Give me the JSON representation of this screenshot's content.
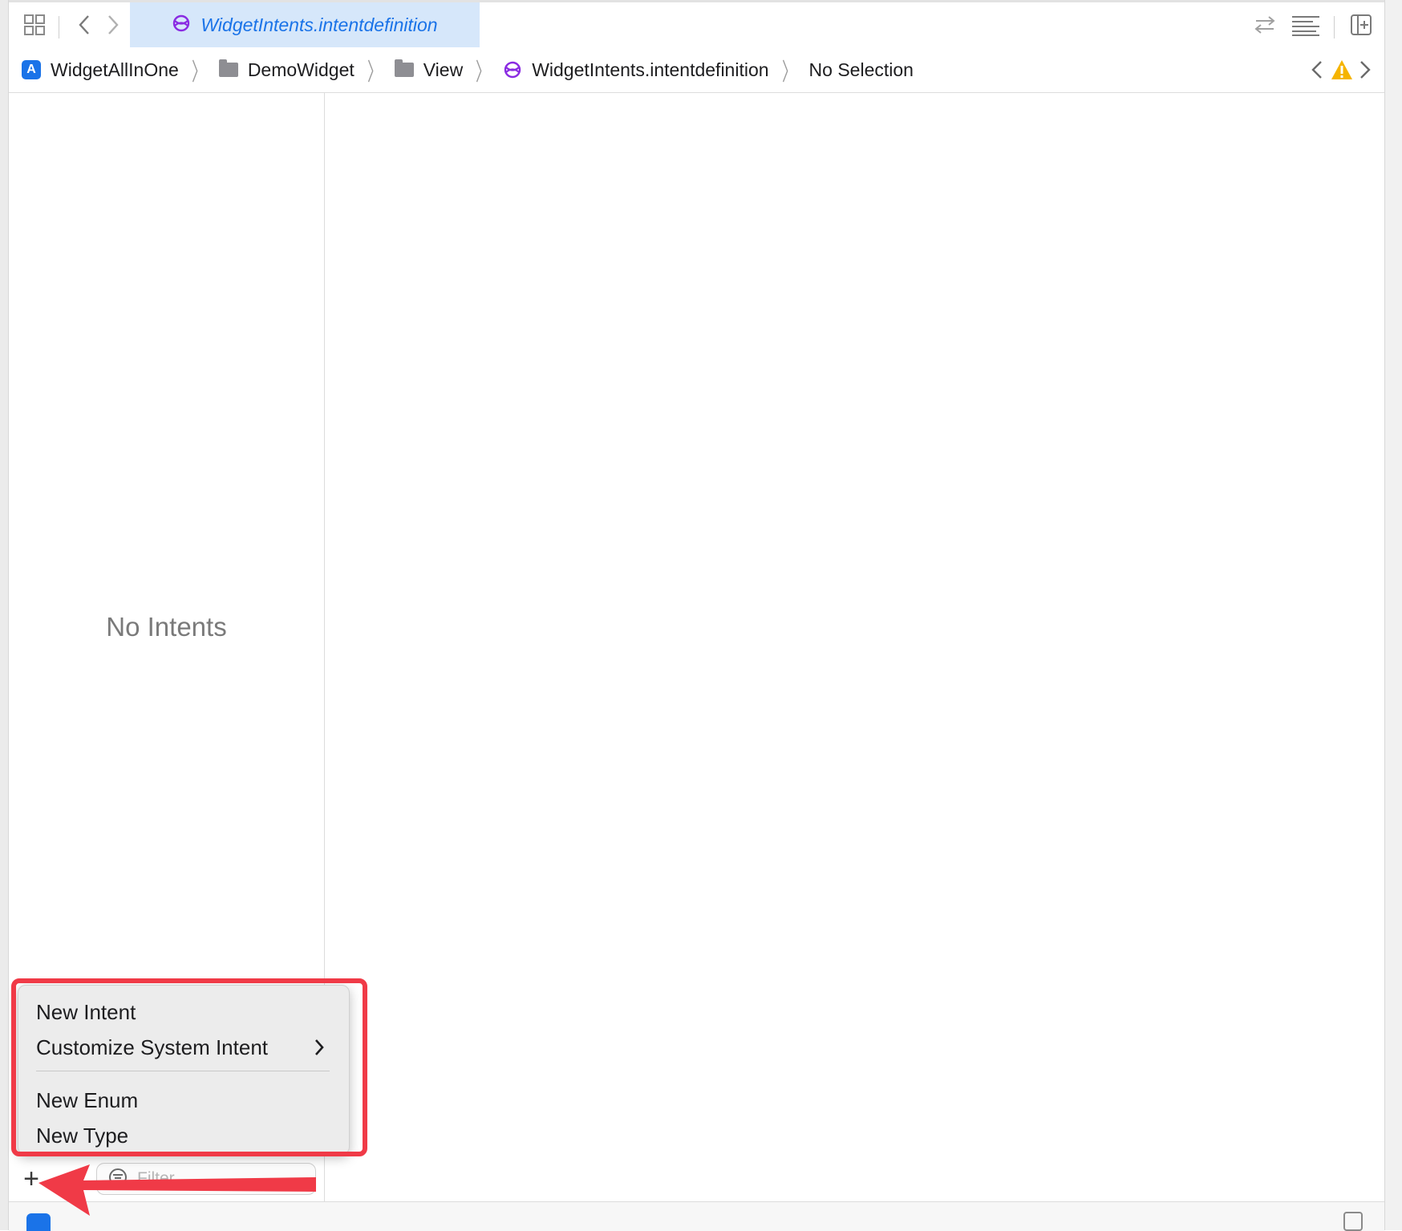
{
  "tab": {
    "title": "WidgetIntents.intentdefinition"
  },
  "breadcrumb": {
    "items": [
      "WidgetAllInOne",
      "DemoWidget",
      "View",
      "WidgetIntents.intentdefinition",
      "No Selection"
    ]
  },
  "sidebar": {
    "empty_text": "No Intents",
    "filter_placeholder": "Filter"
  },
  "menu": {
    "items": [
      "New Intent",
      "Customize System Intent",
      "New Enum",
      "New Type"
    ]
  },
  "colors": {
    "accent": "#1a73e8",
    "intent_purple": "#8a2be2",
    "warning": "#f5b400",
    "annotation_red": "#f03a47"
  }
}
